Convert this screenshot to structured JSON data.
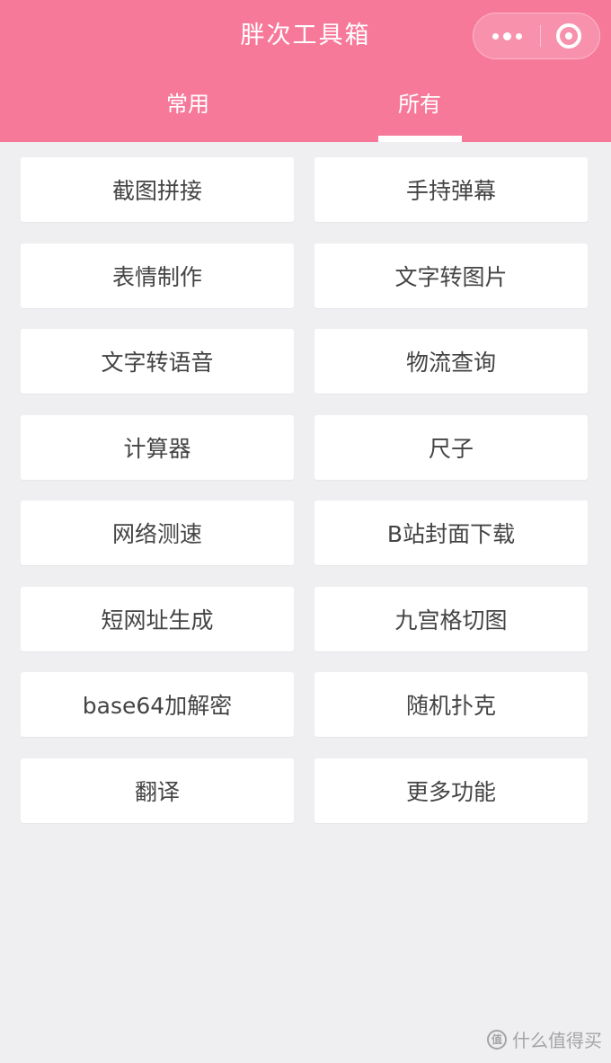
{
  "header": {
    "title": "胖次工具箱",
    "background": "#f7799a",
    "capsule": {
      "more_icon": "more-dots-icon",
      "close_icon": "close-target-icon"
    },
    "tabs": [
      {
        "label": "常用",
        "active": false
      },
      {
        "label": "所有",
        "active": true
      }
    ]
  },
  "tools": [
    {
      "label": "截图拼接"
    },
    {
      "label": "手持弹幕"
    },
    {
      "label": "表情制作"
    },
    {
      "label": "文字转图片"
    },
    {
      "label": "文字转语音"
    },
    {
      "label": "物流查询"
    },
    {
      "label": "计算器"
    },
    {
      "label": "尺子"
    },
    {
      "label": "网络测速"
    },
    {
      "label": "B站封面下载"
    },
    {
      "label": "短网址生成"
    },
    {
      "label": "九宫格切图"
    },
    {
      "label": "base64加解密"
    },
    {
      "label": "随机扑克"
    },
    {
      "label": "翻译"
    },
    {
      "label": "更多功能"
    }
  ],
  "watermark": {
    "badge": "值",
    "text": "什么值得买"
  }
}
